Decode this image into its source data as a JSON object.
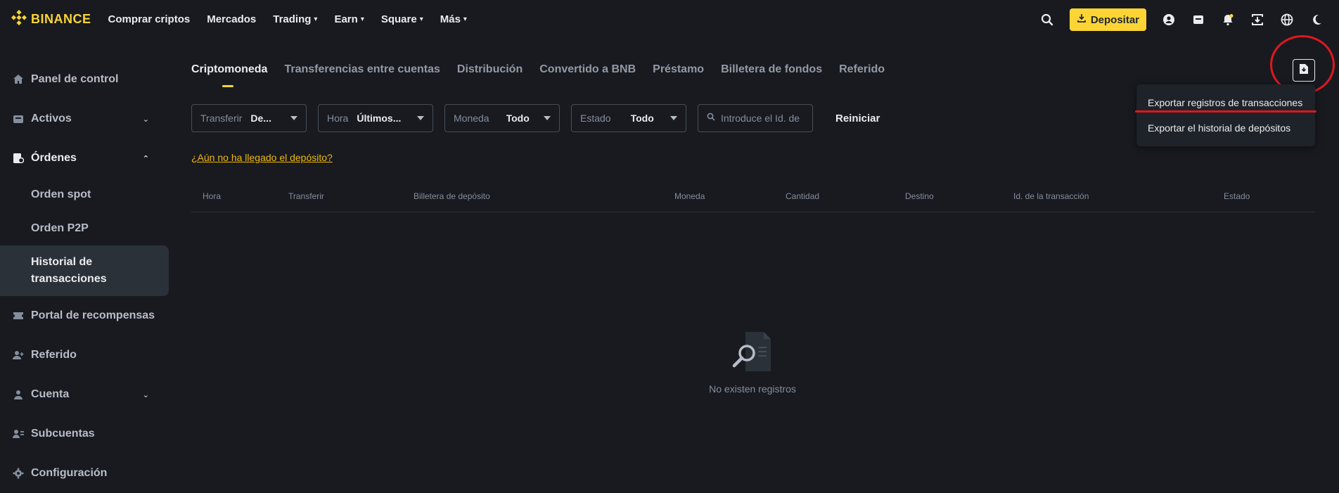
{
  "brand": {
    "name": "BINANCE",
    "color": "#fcd535"
  },
  "nav": [
    {
      "label": "Comprar criptos",
      "chevron": false
    },
    {
      "label": "Mercados",
      "chevron": false
    },
    {
      "label": "Trading",
      "chevron": true
    },
    {
      "label": "Earn",
      "chevron": true
    },
    {
      "label": "Square",
      "chevron": true
    },
    {
      "label": "Más",
      "chevron": true
    }
  ],
  "header_actions": {
    "deposit_label": "Depositar",
    "icons": [
      "search-icon",
      "user-icon",
      "wallet-icon",
      "bell-icon",
      "download-app-icon",
      "globe-icon",
      "moon-icon"
    ]
  },
  "sidebar": {
    "items": [
      {
        "label": "Panel de control",
        "icon": "home-icon"
      },
      {
        "label": "Activos",
        "icon": "wallet-icon",
        "chevron": "down"
      },
      {
        "label": "Órdenes",
        "icon": "orders-icon",
        "chevron": "up",
        "open": true
      },
      {
        "label": "Orden spot",
        "sub": true
      },
      {
        "label": "Orden P2P",
        "sub": true
      },
      {
        "label": "Historial de transacciones",
        "sub": true,
        "active": true
      },
      {
        "label": "Portal de recompensas",
        "icon": "ticket-icon"
      },
      {
        "label": "Referido",
        "icon": "user-plus-icon"
      },
      {
        "label": "Cuenta",
        "icon": "user-icon",
        "chevron": "down"
      },
      {
        "label": "Subcuentas",
        "icon": "subaccounts-icon"
      },
      {
        "label": "Configuración",
        "icon": "gear-icon"
      }
    ]
  },
  "tabs": [
    {
      "label": "Criptomoneda",
      "active": true
    },
    {
      "label": "Transferencias entre cuentas"
    },
    {
      "label": "Distribución"
    },
    {
      "label": "Convertido a BNB"
    },
    {
      "label": "Préstamo"
    },
    {
      "label": "Billetera de fondos"
    },
    {
      "label": "Referido"
    }
  ],
  "filters": {
    "transfer": {
      "label": "Transferir",
      "value": "De..."
    },
    "time": {
      "label": "Hora",
      "value": "Últimos..."
    },
    "currency": {
      "label": "Moneda",
      "value": "Todo"
    },
    "status": {
      "label": "Estado",
      "value": "Todo"
    },
    "search_placeholder": "Introduce el Id. de",
    "reset_label": "Reiniciar"
  },
  "not_arrived_link": "¿Aún no ha llegado el depósito?",
  "table": {
    "columns": [
      "Hora",
      "Transferir",
      "Billetera de depósito",
      "Moneda",
      "Cantidad",
      "Destino",
      "Id. de la transacción",
      "Estado"
    ]
  },
  "empty_state": {
    "label": "No existen registros"
  },
  "export_menu": {
    "items": [
      "Exportar registros de transacciones",
      "Exportar el historial de depósitos"
    ],
    "highlight_color": "#e0161e"
  }
}
